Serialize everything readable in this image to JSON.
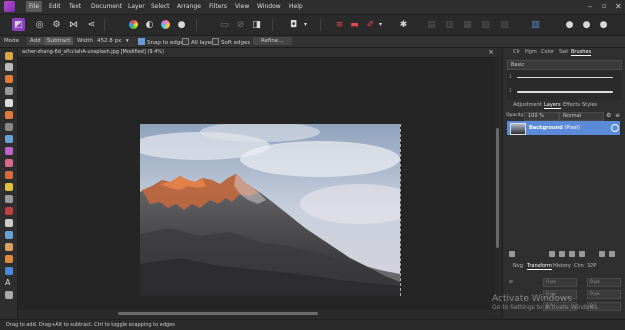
{
  "menu": {
    "items": [
      "File",
      "Edit",
      "Text",
      "Document",
      "Layer",
      "Select",
      "Arrange",
      "Filters",
      "View",
      "Window",
      "Help"
    ],
    "active": "File"
  },
  "window_controls": {
    "minimize": "–",
    "maximize": "▫",
    "close": "✕"
  },
  "context": {
    "mode_label": "Mode",
    "add_label": "Add",
    "subtract_label": "Subtract",
    "width_label": "Width",
    "width_value": "452.8 px",
    "snap_label": "Snap to edges",
    "all_layers_label": "All layers",
    "soft_edges_label": "Soft edges",
    "refine_label": "Refine..."
  },
  "document": {
    "title": "acher-zhang-6d_sPcclahA-unsplash.jpg [Modified] (9.4%)",
    "close_symbol": "×"
  },
  "panels": {
    "top_tabs": [
      "Clr",
      "Hgm",
      "Color",
      "Swt",
      "Brushes"
    ],
    "top_active": "Brushes",
    "brush_category": "Basic",
    "brush_sizes": [
      "1",
      "1"
    ],
    "layer_tabs": [
      "Adjustment",
      "Layers",
      "Effects",
      "Styles"
    ],
    "layer_active": "Layers",
    "opacity_label": "Opacity:",
    "opacity_value": "100 %",
    "blend_mode": "Normal",
    "layer_name": "Background",
    "layer_type": "(Pixel)",
    "bottom_tabs": [
      "Nvg",
      "Transform",
      "History",
      "Chn",
      "32P"
    ],
    "bottom_active": "Transform",
    "transform_fields": [
      "0 px",
      "0 px",
      "0 px",
      "0 px",
      "0 °",
      "0 °"
    ]
  },
  "status": {
    "text": "Drag to add. Drag+Alt to subtract. Ctrl to toggle snapping to edges"
  },
  "watermark": {
    "line1": "Activate Windows",
    "line2": "Go to Settings to activate Windows."
  },
  "colors": {
    "accent": "#5b8ad8",
    "app_logo": "#b44ad0",
    "bg": "#2b2b2b"
  }
}
